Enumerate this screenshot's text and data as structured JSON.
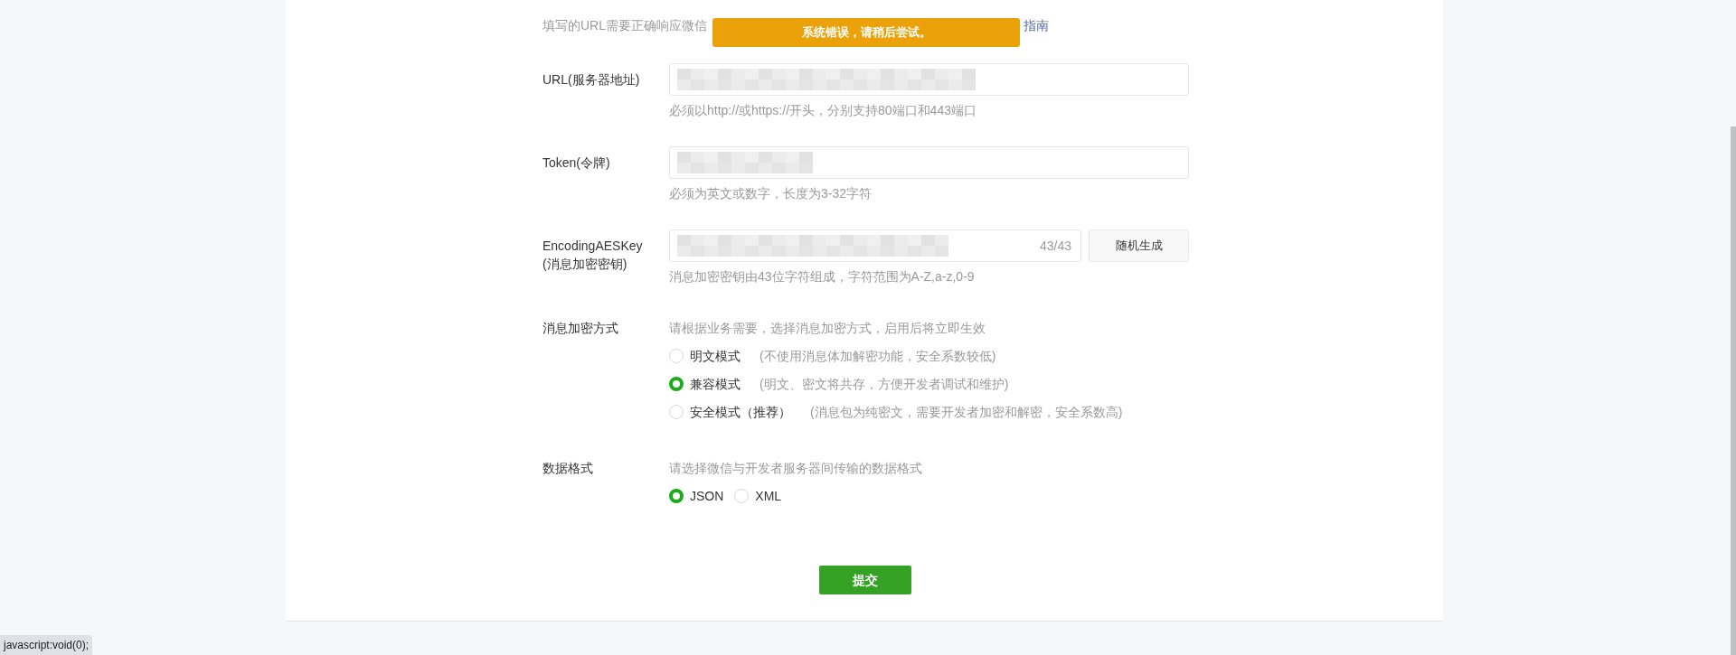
{
  "toast": {
    "text": "系统错误，请稍后尝试。"
  },
  "intro": {
    "text": "填写的URL需要正确响应微信",
    "link": "指南"
  },
  "fields": [
    {
      "kind": "text",
      "label": "URL(服务器地址)",
      "hint": "必须以http://或https://开头，分别支持80端口和443端口"
    },
    {
      "kind": "text",
      "label": "Token(令牌)",
      "hint": "必须为英文或数字，长度为3-32字符"
    },
    {
      "kind": "key",
      "label": "EncodingAESKey",
      "sublabel": "(消息加密密钥)",
      "count": "43/43",
      "button": "随机生成",
      "hint": "消息加密密钥由43位字符组成，字符范围为A-Z,a-z,0-9"
    }
  ],
  "encryption": {
    "label": "消息加密方式",
    "hint": "请根据业务需要，选择消息加密方式，启用后将立即生效",
    "options": [
      {
        "label": "明文模式",
        "note": "(不使用消息体加解密功能，安全系数较低)",
        "selected": false
      },
      {
        "label": "兼容模式",
        "note": "(明文、密文将共存，方便开发者调试和维护)",
        "selected": true
      },
      {
        "label": "安全模式（推荐）",
        "note": "(消息包为纯密文，需要开发者加密和解密，安全系数高)",
        "selected": false
      }
    ]
  },
  "format": {
    "label": "数据格式",
    "hint": "请选择微信与开发者服务器间传输的数据格式",
    "options": [
      {
        "label": "JSON",
        "selected": true
      },
      {
        "label": "XML",
        "selected": false
      }
    ]
  },
  "submit": "提交",
  "status_bar": "javascript:void(0);"
}
